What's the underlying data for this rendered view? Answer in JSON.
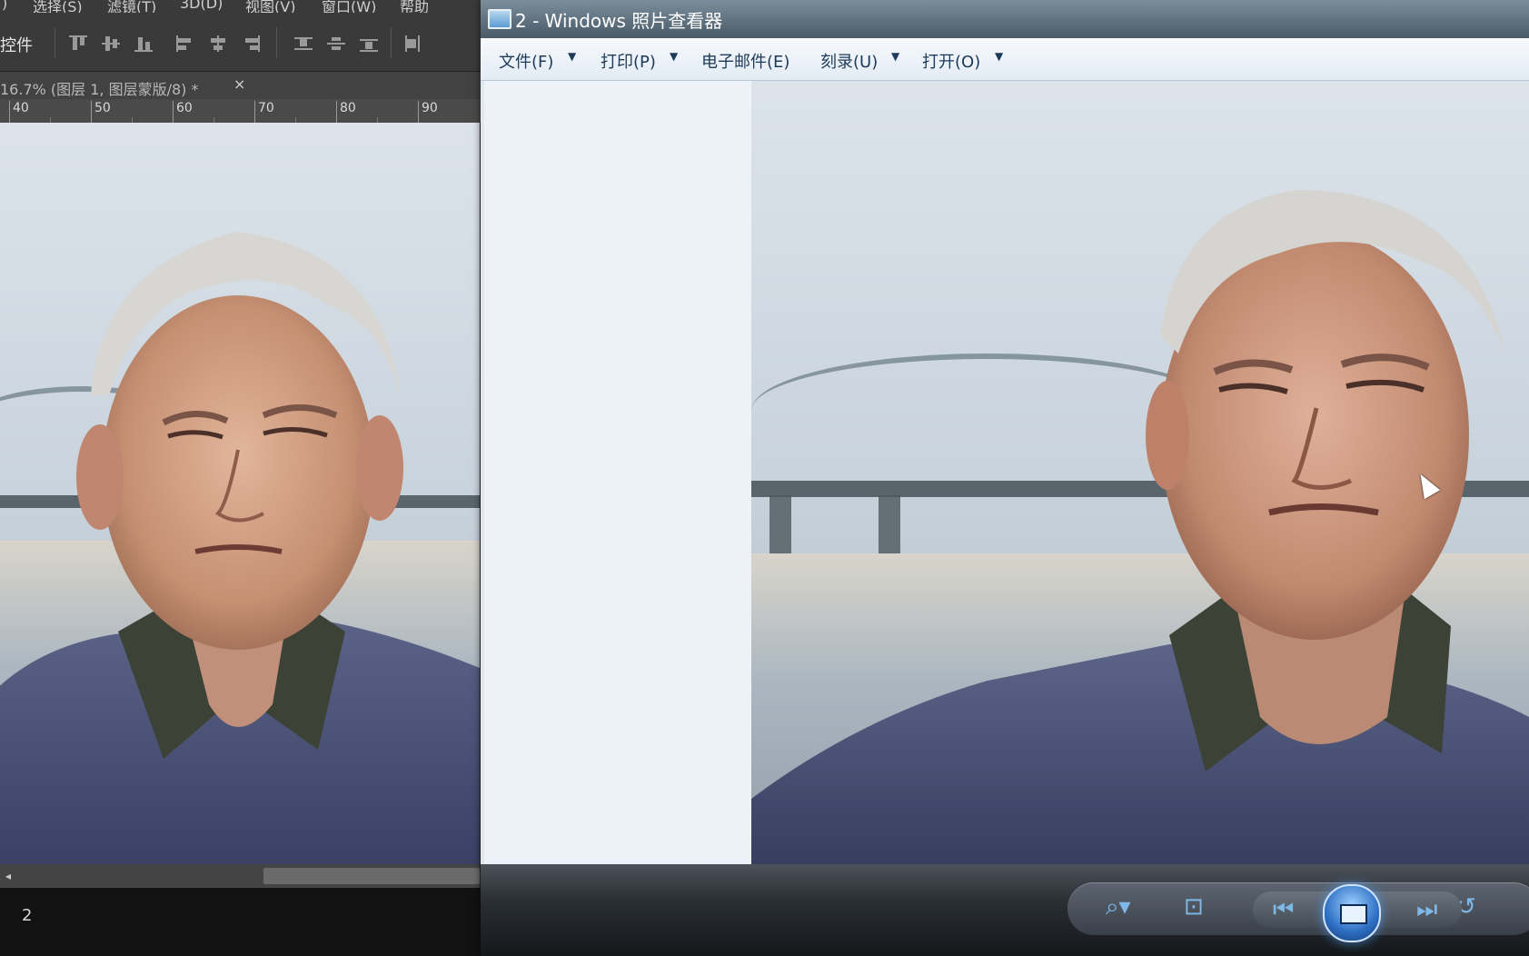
{
  "photoshop": {
    "menu_items": [
      "选择(S)",
      "滤镜(T)",
      "3D(D)",
      "视图(V)",
      "窗口(W)",
      "帮助"
    ],
    "menu_leading": ")",
    "options_label": "控件",
    "document_tab": "16.7% (图层 1, 图层蒙版/8) *",
    "document_close": "×",
    "ruler_labels": [
      "40",
      "50",
      "60",
      "70",
      "80",
      "90"
    ],
    "status_page_number": "2"
  },
  "viewer": {
    "title": "2 - Windows 照片查看器",
    "commands": [
      {
        "label": "文件(F)",
        "has_dropdown": true
      },
      {
        "label": "打印(P)",
        "has_dropdown": true
      },
      {
        "label": "电子邮件(E)",
        "has_dropdown": false
      },
      {
        "label": "刻录(U)",
        "has_dropdown": true
      },
      {
        "label": "打开(O)",
        "has_dropdown": true
      }
    ],
    "dropdown_glyph": "▼",
    "controls": {
      "zoom_icon": "⌕▾",
      "actual_size_icon": "⊡",
      "previous_icon": "⏮",
      "next_icon": "⏭",
      "rotate_icon": "↺"
    }
  },
  "colors": {
    "accent_blue": "#2d6fc4",
    "ps_background": "#2b2b2b",
    "viewer_chrome": "#dfe7ef"
  }
}
